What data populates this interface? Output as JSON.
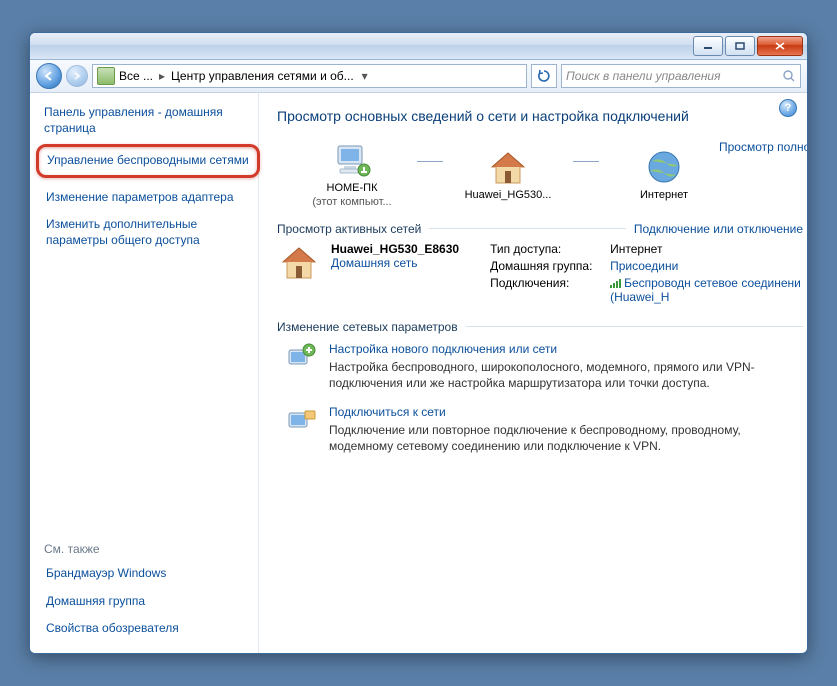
{
  "breadcrumb": {
    "level1": "Все ...",
    "level2": "Центр управления сетями и об..."
  },
  "search": {
    "placeholder": "Поиск в панели управления"
  },
  "sidebar": {
    "home": "Панель управления - домашняя страница",
    "items": [
      "Управление беспроводными сетями",
      "Изменение параметров адаптера",
      "Изменить дополнительные параметры общего доступа"
    ],
    "see_also_label": "См. также",
    "see_also": [
      "Брандмауэр Windows",
      "Домашняя группа",
      "Свойства обозревателя"
    ]
  },
  "main": {
    "title": "Просмотр основных сведений о сети и настройка подключений",
    "full_map": "Просмотр полной карты",
    "map": {
      "pc": {
        "label": "HOME-ПК",
        "sub": "(этот компьют..."
      },
      "router": {
        "label": "Huawei_HG530..."
      },
      "internet": {
        "label": "Интернет"
      }
    },
    "active_label": "Просмотр активных сетей",
    "active_link": "Подключение или отключение",
    "network": {
      "name": "Huawei_HG530_E8630",
      "type": "Домашняя сеть",
      "kv": {
        "access_k": "Тип доступа:",
        "access_v": "Интернет",
        "home_k": "Домашняя группа:",
        "home_v": "Присоедини",
        "conn_k": "Подключения:",
        "conn_v": "Беспроводн сетевое соединени (Huawei_H"
      }
    },
    "settings_label": "Изменение сетевых параметров",
    "tasks": [
      {
        "title": "Настройка нового подключения или сети",
        "desc": "Настройка беспроводного, широкополосного, модемного, прямого или VPN-подключения или же настройка маршрутизатора или точки доступа."
      },
      {
        "title": "Подключиться к сети",
        "desc": "Подключение или повторное подключение к беспроводному, проводному, модемному сетевому соединению или подключение к VPN."
      }
    ]
  }
}
